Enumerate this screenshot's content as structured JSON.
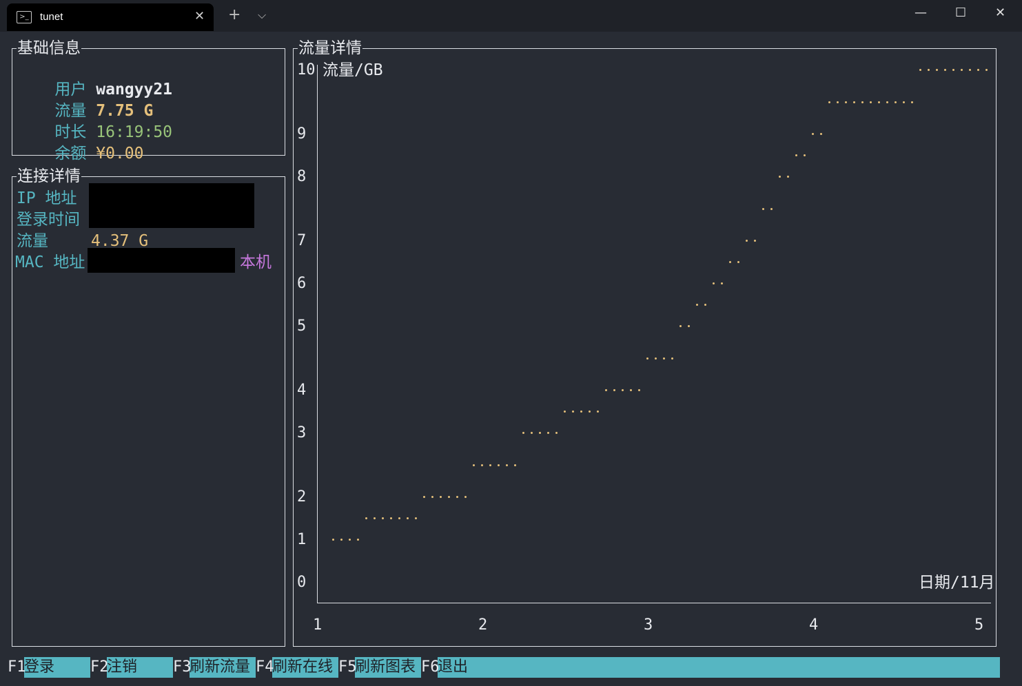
{
  "window": {
    "tab_title": "tunet",
    "tab_icon": "terminal-icon",
    "close_tab_glyph": "✕",
    "new_tab_glyph": "+",
    "dropdown_glyph": "⌵",
    "minimize_glyph": "—",
    "maximize_glyph": "☐",
    "close_glyph": "✕"
  },
  "basic": {
    "title": "基础信息",
    "user_label": "用户",
    "user_value": "wangyy21",
    "flow_label": "流量",
    "flow_value": "7.75 G",
    "duration_label": "时长",
    "duration_value": "16:19:50",
    "balance_label": "余额",
    "balance_value": "¥0.00"
  },
  "connection": {
    "title": "连接详情",
    "ip_label": "IP 地址",
    "login_time_label": "登录时间",
    "flow_label": "流量",
    "flow_value": "4.37 G",
    "mac_label": "MAC 地址",
    "local_tag": "本机"
  },
  "chart_panel": {
    "title": "流量详情"
  },
  "chart_data": {
    "type": "scatter",
    "title": "",
    "ylabel": "流量/GB",
    "xlabel": "日期/11月",
    "x_ticks": [
      "1",
      "2",
      "3",
      "4",
      "5"
    ],
    "y_ticks": [
      "0",
      "1",
      "2",
      "3",
      "4",
      "5",
      "6",
      "7",
      "8",
      "9",
      "10"
    ],
    "xlim": [
      1,
      5
    ],
    "ylim": [
      0,
      10
    ],
    "color": "#e5c07b",
    "x": [
      1.05,
      1.1,
      1.15,
      1.2,
      1.25,
      1.3,
      1.35,
      1.4,
      1.45,
      1.5,
      1.55,
      1.6,
      1.65,
      1.7,
      1.75,
      1.8,
      1.85,
      1.9,
      1.95,
      2.0,
      2.05,
      2.1,
      2.15,
      2.2,
      2.25,
      2.3,
      2.35,
      2.4,
      2.45,
      2.5,
      2.55,
      2.6,
      2.65,
      2.7,
      2.75,
      2.8,
      2.85,
      2.9,
      2.95,
      3.0,
      3.05,
      3.1,
      3.15,
      3.2,
      3.25,
      3.3,
      3.35,
      3.4,
      3.45,
      3.5,
      3.55,
      3.6,
      3.65,
      3.7,
      3.75,
      3.8,
      3.85,
      3.9,
      3.95,
      4.0,
      4.05,
      4.1,
      4.15,
      4.2,
      4.25,
      4.3,
      4.35,
      4.4,
      4.45,
      4.5,
      4.55,
      4.6,
      4.65,
      4.7,
      4.75,
      4.8,
      4.85,
      4.9,
      4.95,
      5.0
    ],
    "y": [
      1.0,
      1.0,
      1.0,
      1.0,
      1.5,
      1.5,
      1.5,
      1.5,
      1.5,
      1.5,
      1.5,
      2.0,
      2.0,
      2.0,
      2.0,
      2.0,
      2.0,
      2.5,
      2.5,
      2.5,
      2.5,
      2.5,
      2.5,
      3.0,
      3.0,
      3.0,
      3.0,
      3.0,
      3.5,
      3.5,
      3.5,
      3.5,
      3.5,
      4.0,
      4.0,
      4.0,
      4.0,
      4.0,
      4.5,
      4.5,
      4.5,
      4.5,
      5.0,
      5.0,
      5.5,
      5.5,
      6.0,
      6.0,
      6.5,
      6.5,
      7.0,
      7.0,
      7.5,
      7.5,
      8.0,
      8.0,
      8.5,
      8.5,
      9.0,
      9.0,
      9.5,
      9.5,
      9.5,
      9.5,
      9.5,
      9.5,
      9.5,
      9.5,
      9.5,
      9.5,
      9.5,
      10.0,
      10.0,
      10.0,
      10.0,
      10.0,
      10.0,
      10.0,
      10.0,
      10.0
    ]
  },
  "function_bar": [
    {
      "key": "F1",
      "label": "登录"
    },
    {
      "key": "F2",
      "label": "注销"
    },
    {
      "key": "F3",
      "label": "刷新流量"
    },
    {
      "key": "F4",
      "label": "刷新在线"
    },
    {
      "key": "F5",
      "label": "刷新图表"
    },
    {
      "key": "F6",
      "label": "退出"
    }
  ]
}
